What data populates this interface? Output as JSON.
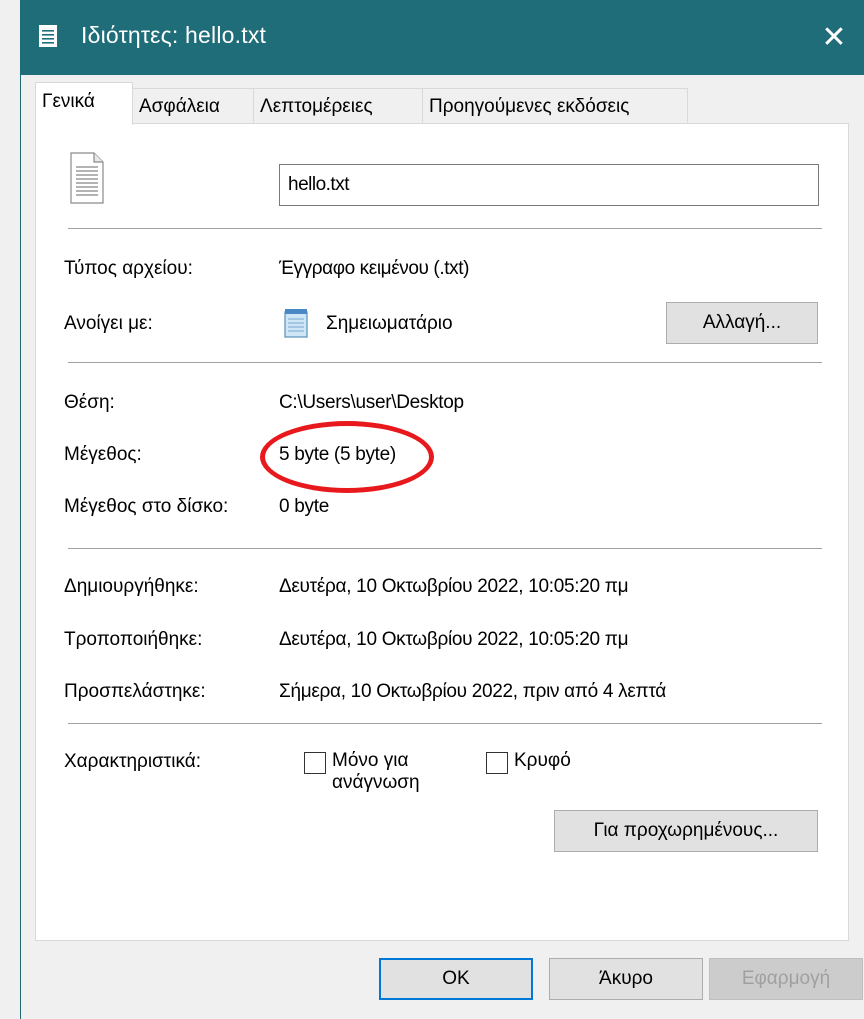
{
  "window": {
    "title": "Ιδιότητες: hello.txt",
    "close_symbol": "✕",
    "title_icon": "document-icon"
  },
  "tabs": [
    {
      "label": "Γενικά",
      "active": true
    },
    {
      "label": "Ασφάλεια",
      "active": false
    },
    {
      "label": "Λεπτομέρειες",
      "active": false
    },
    {
      "label": "Προηγούμενες εκδόσεις",
      "active": false
    }
  ],
  "general": {
    "file_icon": "text-file-icon",
    "filename": "hello.txt",
    "file_type_label": "Τύπος αρχείου:",
    "file_type_value": "Έγγραφο κειμένου (.txt)",
    "opens_with_label": "Ανοίγει με:",
    "opens_with_app": "Σημειωματάριο",
    "opens_with_icon": "notepad-icon",
    "change_button": "Αλλαγή...",
    "location_label": "Θέση:",
    "location_value": "C:\\Users\\user\\Desktop",
    "size_label": "Μέγεθος:",
    "size_value": "5 byte (5 byte)",
    "size_on_disk_label": "Μέγεθος στο δίσκο:",
    "size_on_disk_value": "0 byte",
    "created_label": "Δημιουργήθηκε:",
    "created_value": "Δευτέρα, 10 Οκτωβρίου 2022, 10:05:20 πμ",
    "modified_label": "Τροποποιήθηκε:",
    "modified_value": "Δευτέρα, 10 Οκτωβρίου 2022, 10:05:20 πμ",
    "accessed_label": "Προσπελάστηκε:",
    "accessed_value": "Σήμερα, 10 Οκτωβρίου 2022, πριν από 4 λεπτά",
    "attributes_label": "Χαρακτηριστικά:",
    "readonly_label_line1": "Μόνο για",
    "readonly_label_line2": "ανάγνωση",
    "readonly_checked": false,
    "hidden_label": "Κρυφό",
    "hidden_checked": false,
    "advanced_button": "Για προχωρημένους..."
  },
  "footer": {
    "ok_button": "OK",
    "cancel_button": "Άκυρο",
    "apply_button": "Εφαρμογή"
  },
  "colors": {
    "titlebar": "#1f6d78",
    "highlight": "#e8191d",
    "default_button_border": "#0078d7"
  }
}
